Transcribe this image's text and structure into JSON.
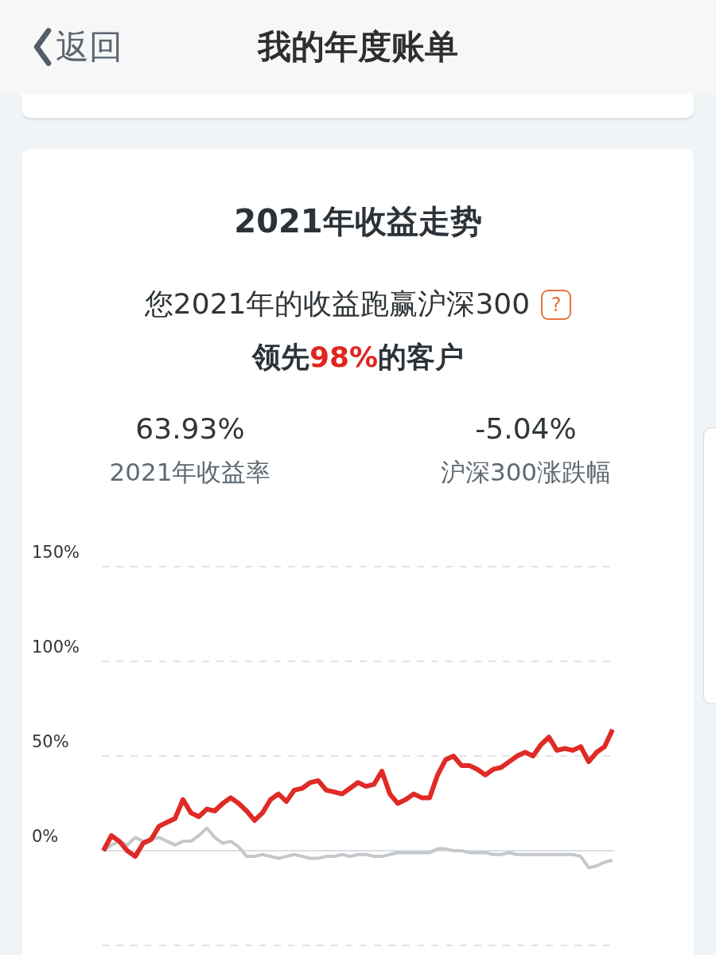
{
  "header": {
    "back": "返回",
    "title": "我的年度账单"
  },
  "card": {
    "title": "2021年收益走势",
    "subtitle": "您2021年的收益跑赢沪深300",
    "help": "?",
    "lead": "领先**98%**的客户",
    "stats": [
      {
        "value": "63.93%",
        "label": "2021年收益率"
      },
      {
        "value": "-5.04%",
        "label": "沪深300涨跌幅"
      }
    ],
    "chart_data": {
      "type": "line",
      "ylim": [
        -50,
        150
      ],
      "yticks": [
        {
          "value": 0,
          "label": "0%"
        },
        {
          "value": 50,
          "label": "50%"
        },
        {
          "value": 100,
          "label": "100%"
        },
        {
          "value": 150,
          "label": "150%"
        }
      ],
      "series": [
        {
          "color": "#e02a26",
          "values": [
            0,
            8,
            5,
            0,
            -3,
            4,
            6,
            13,
            15,
            17,
            27,
            20,
            18,
            22,
            21,
            25,
            28,
            25,
            21,
            16,
            20,
            27,
            30,
            26,
            32,
            33,
            36,
            37,
            32,
            31,
            30,
            33,
            36,
            34,
            35,
            42,
            30,
            25,
            27,
            30,
            28,
            28,
            40,
            48,
            50,
            45,
            45,
            43,
            40,
            43,
            44,
            47,
            50,
            52,
            50,
            56,
            60,
            53,
            54,
            53,
            55,
            47,
            52,
            55,
            64
          ]
        },
        {
          "color": "#c3c8cc",
          "values": [
            0,
            3,
            5,
            3,
            7,
            5,
            6,
            7,
            5,
            3,
            5,
            5,
            8,
            12,
            7,
            4,
            5,
            2,
            -3,
            -3,
            -2,
            -3,
            -4,
            -3,
            -2,
            -3,
            -4,
            -4,
            -3,
            -3,
            -2,
            -3,
            -2,
            -2,
            -3,
            -3,
            -2,
            -1,
            -1,
            -1,
            -1,
            -1,
            1,
            1,
            0,
            0,
            -1,
            -1,
            -1,
            -2,
            -2,
            -1,
            -2,
            -2,
            -2,
            -2,
            -2,
            -2,
            -2,
            -2,
            -3,
            -9,
            -8,
            -6,
            -5
          ]
        }
      ]
    }
  }
}
